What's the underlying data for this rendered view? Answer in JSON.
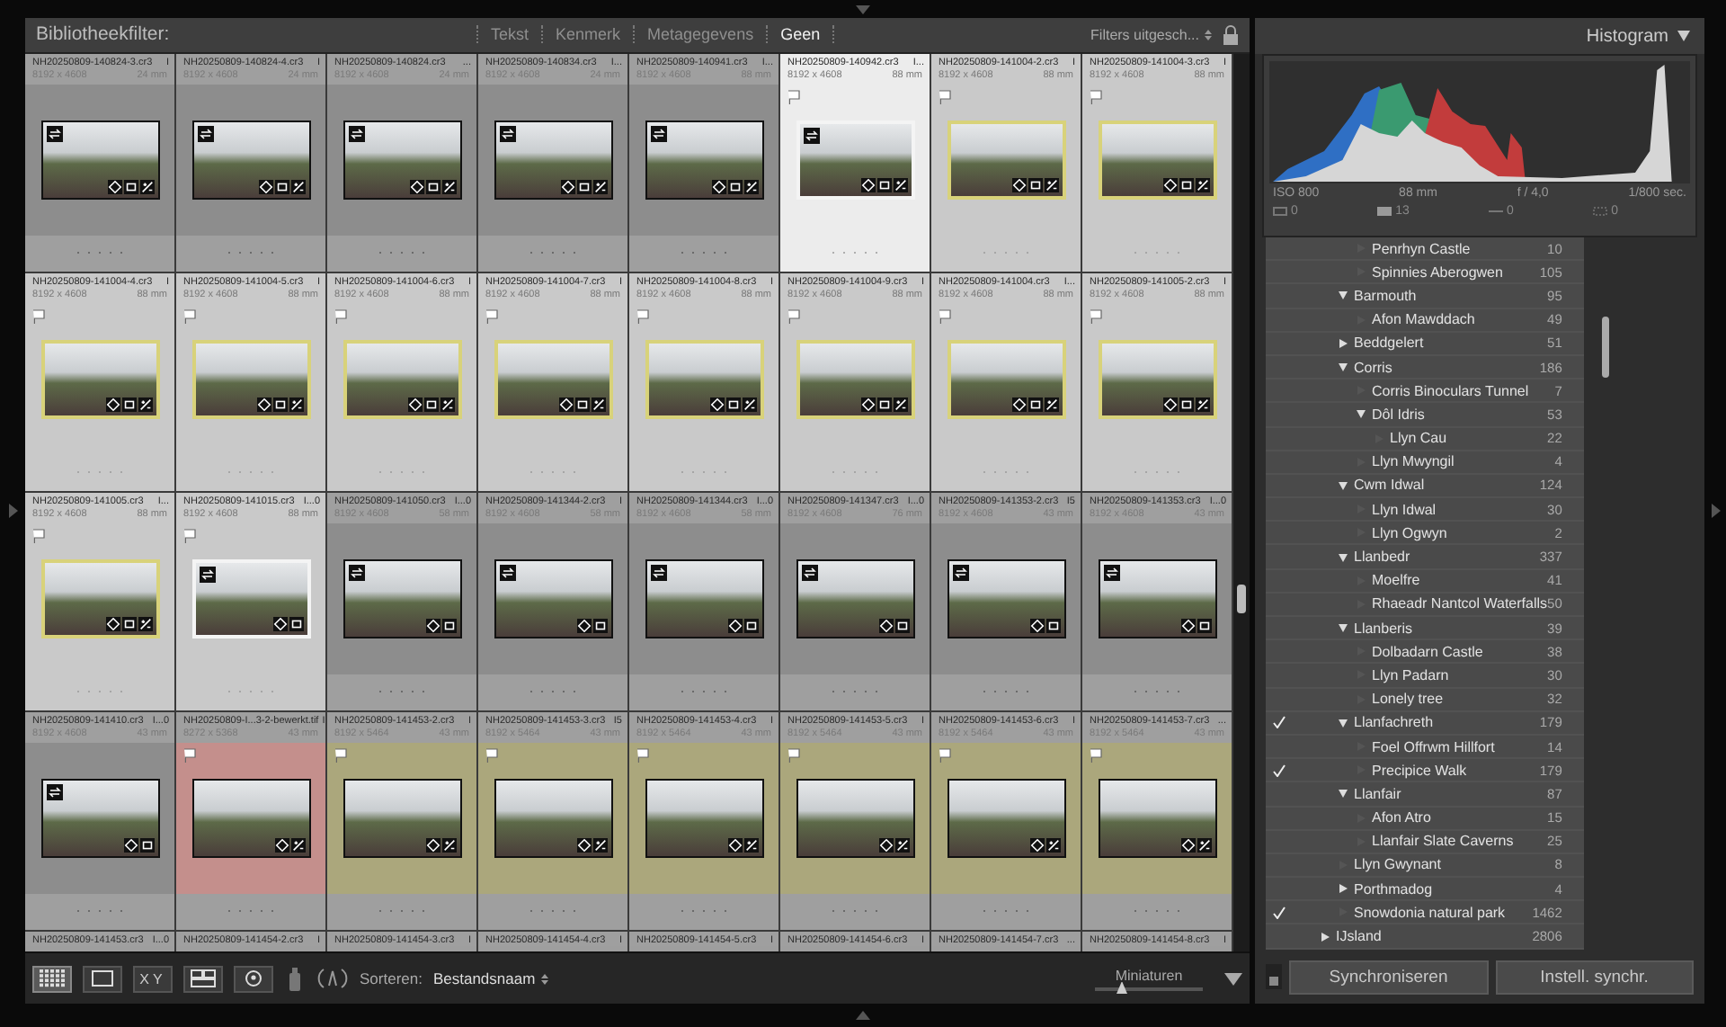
{
  "filter_bar": {
    "label": "Bibliotheekfilter:",
    "tabs": [
      {
        "label": "Tekst",
        "selected": false
      },
      {
        "label": "Kenmerk",
        "selected": false
      },
      {
        "label": "Metagegevens",
        "selected": false
      },
      {
        "label": "Geen",
        "selected": true
      }
    ],
    "preset": "Filters uitgesch..."
  },
  "thumbnails": [
    {
      "name": "NH20250809-140824-3.cr3",
      "extra": "I",
      "dims": "8192 x 4608",
      "focal": "24 mm",
      "selected": false,
      "active": false,
      "flag": false,
      "stars": 0,
      "virtual_copy": true,
      "keywords": true,
      "cropped": true,
      "edited": true
    },
    {
      "name": "NH20250809-140824-4.cr3",
      "extra": "I",
      "dims": "8192 x 4608",
      "focal": "24 mm",
      "selected": false,
      "active": false,
      "flag": false,
      "stars": 0,
      "virtual_copy": true,
      "keywords": true,
      "cropped": true,
      "edited": true
    },
    {
      "name": "NH20250809-140824.cr3",
      "extra": "...",
      "dims": "8192 x 4608",
      "focal": "24 mm",
      "selected": false,
      "active": false,
      "flag": false,
      "stars": 0,
      "virtual_copy": true,
      "keywords": true,
      "cropped": true,
      "edited": true
    },
    {
      "name": "NH20250809-140834.cr3",
      "extra": "I...",
      "dims": "8192 x 4608",
      "focal": "24 mm",
      "selected": false,
      "active": false,
      "flag": false,
      "stars": 0,
      "virtual_copy": true,
      "keywords": true,
      "cropped": true,
      "edited": true
    },
    {
      "name": "NH20250809-140941.cr3",
      "extra": "I...",
      "dims": "8192 x 4608",
      "focal": "88 mm",
      "selected": false,
      "active": false,
      "flag": false,
      "stars": 0,
      "virtual_copy": true,
      "keywords": true,
      "cropped": true,
      "edited": true
    },
    {
      "name": "NH20250809-140942.cr3",
      "extra": "I...",
      "dims": "8192 x 4608",
      "focal": "88 mm",
      "selected": true,
      "active": true,
      "flag": true,
      "stars": 0,
      "virtual_copy": true,
      "keywords": true,
      "cropped": true,
      "edited": true
    },
    {
      "name": "NH20250809-141004-2.cr3",
      "extra": "I",
      "dims": "8192 x 4608",
      "focal": "88 mm",
      "selected": true,
      "active": false,
      "flag": true,
      "stars": 0,
      "color": "#d8d27a",
      "virtual_copy": false,
      "keywords": true,
      "cropped": true,
      "edited": true
    },
    {
      "name": "NH20250809-141004-3.cr3",
      "extra": "I",
      "dims": "8192 x 4608",
      "focal": "88 mm",
      "selected": true,
      "active": false,
      "flag": true,
      "stars": 0,
      "color": "#d8d27a",
      "virtual_copy": false,
      "keywords": true,
      "cropped": true,
      "edited": true
    },
    {
      "name": "NH20250809-141004-4.cr3",
      "extra": "I",
      "dims": "8192 x 4608",
      "focal": "88 mm",
      "selected": true,
      "active": false,
      "flag": true,
      "stars": 0,
      "color": "#d8d27a",
      "virtual_copy": false,
      "keywords": true,
      "cropped": true,
      "edited": true
    },
    {
      "name": "NH20250809-141004-5.cr3",
      "extra": "I",
      "dims": "8192 x 4608",
      "focal": "88 mm",
      "selected": true,
      "active": false,
      "flag": true,
      "stars": 0,
      "color": "#d8d27a",
      "virtual_copy": false,
      "keywords": true,
      "cropped": true,
      "edited": true
    },
    {
      "name": "NH20250809-141004-6.cr3",
      "extra": "I",
      "dims": "8192 x 4608",
      "focal": "88 mm",
      "selected": true,
      "active": false,
      "flag": true,
      "stars": 0,
      "color": "#d8d27a",
      "virtual_copy": false,
      "keywords": true,
      "cropped": true,
      "edited": true
    },
    {
      "name": "NH20250809-141004-7.cr3",
      "extra": "I",
      "dims": "8192 x 4608",
      "focal": "88 mm",
      "selected": true,
      "active": false,
      "flag": true,
      "stars": 0,
      "color": "#d8d27a",
      "virtual_copy": false,
      "keywords": true,
      "cropped": true,
      "edited": true
    },
    {
      "name": "NH20250809-141004-8.cr3",
      "extra": "I",
      "dims": "8192 x 4608",
      "focal": "88 mm",
      "selected": true,
      "active": false,
      "flag": true,
      "stars": 0,
      "color": "#d8d27a",
      "virtual_copy": false,
      "keywords": true,
      "cropped": true,
      "edited": true
    },
    {
      "name": "NH20250809-141004-9.cr3",
      "extra": "I",
      "dims": "8192 x 4608",
      "focal": "88 mm",
      "selected": true,
      "active": false,
      "flag": true,
      "stars": 0,
      "color": "#d8d27a",
      "virtual_copy": false,
      "keywords": true,
      "cropped": true,
      "edited": true
    },
    {
      "name": "NH20250809-141004.cr3",
      "extra": "I...",
      "dims": "8192 x 4608",
      "focal": "88 mm",
      "selected": true,
      "active": false,
      "flag": true,
      "stars": 0,
      "color": "#d8d27a",
      "virtual_copy": false,
      "keywords": true,
      "cropped": true,
      "edited": true
    },
    {
      "name": "NH20250809-141005-2.cr3",
      "extra": "I",
      "dims": "8192 x 4608",
      "focal": "88 mm",
      "selected": true,
      "active": false,
      "flag": true,
      "stars": 0,
      "color": "#d8d27a",
      "virtual_copy": false,
      "keywords": true,
      "cropped": true,
      "edited": true
    },
    {
      "name": "NH20250809-141005.cr3",
      "extra": "I...",
      "dims": "8192 x 4608",
      "focal": "88 mm",
      "selected": true,
      "active": false,
      "flag": true,
      "stars": 0,
      "color": "#d8d27a",
      "virtual_copy": false,
      "keywords": true,
      "cropped": true,
      "edited": true
    },
    {
      "name": "NH20250809-141015.cr3",
      "extra": "I...0",
      "dims": "8192 x 4608",
      "focal": "88 mm",
      "selected": true,
      "active": false,
      "flag": true,
      "stars": 0,
      "virtual_copy": true,
      "keywords": true,
      "cropped": true,
      "edited": false
    },
    {
      "name": "NH20250809-141050.cr3",
      "extra": "I...0",
      "dims": "8192 x 4608",
      "focal": "58 mm",
      "selected": false,
      "active": false,
      "flag": false,
      "stars": 0,
      "virtual_copy": true,
      "keywords": true,
      "cropped": true,
      "edited": false
    },
    {
      "name": "NH20250809-141344-2.cr3",
      "extra": "I",
      "dims": "8192 x 4608",
      "focal": "58 mm",
      "selected": false,
      "active": false,
      "flag": false,
      "stars": 0,
      "virtual_copy": true,
      "keywords": true,
      "cropped": true,
      "edited": false
    },
    {
      "name": "NH20250809-141344.cr3",
      "extra": "I...0",
      "dims": "8192 x 4608",
      "focal": "58 mm",
      "selected": false,
      "active": false,
      "flag": false,
      "stars": 0,
      "virtual_copy": true,
      "keywords": true,
      "cropped": true,
      "edited": false
    },
    {
      "name": "NH20250809-141347.cr3",
      "extra": "I...0",
      "dims": "8192 x 4608",
      "focal": "76 mm",
      "selected": false,
      "active": false,
      "flag": false,
      "stars": 0,
      "virtual_copy": true,
      "keywords": true,
      "cropped": true,
      "edited": false
    },
    {
      "name": "NH20250809-141353-2.cr3",
      "extra": "I5",
      "dims": "8192 x 4608",
      "focal": "43 mm",
      "selected": false,
      "active": false,
      "flag": false,
      "stars": 0,
      "virtual_copy": true,
      "keywords": true,
      "cropped": true,
      "edited": false
    },
    {
      "name": "NH20250809-141353.cr3",
      "extra": "I...0",
      "dims": "8192 x 4608",
      "focal": "43 mm",
      "selected": false,
      "active": false,
      "flag": false,
      "stars": 0,
      "virtual_copy": true,
      "keywords": true,
      "cropped": true,
      "edited": false
    },
    {
      "name": "NH20250809-141410.cr3",
      "extra": "I...0",
      "dims": "8192 x 4608",
      "focal": "43 mm",
      "selected": false,
      "active": false,
      "flag": false,
      "stars": 0,
      "virtual_copy": true,
      "keywords": true,
      "cropped": true,
      "edited": false
    },
    {
      "name": "NH20250809-I...3-2-bewerkt.tif",
      "extra": "I",
      "dims": "8272 x 5368",
      "focal": "43 mm",
      "selected": false,
      "active": false,
      "flag": true,
      "stars": 0,
      "color": "#c48f8c",
      "virtual_copy": false,
      "keywords": true,
      "cropped": false,
      "edited": true
    },
    {
      "name": "NH20250809-141453-2.cr3",
      "extra": "I",
      "dims": "8192 x 5464",
      "focal": "43 mm",
      "selected": false,
      "active": false,
      "flag": true,
      "stars": 0,
      "color": "#aba77c",
      "virtual_copy": false,
      "keywords": true,
      "cropped": false,
      "edited": true
    },
    {
      "name": "NH20250809-141453-3.cr3",
      "extra": "I5",
      "dims": "8192 x 5464",
      "focal": "43 mm",
      "selected": false,
      "active": false,
      "flag": true,
      "stars": 0,
      "color": "#aba77c",
      "virtual_copy": false,
      "keywords": true,
      "cropped": false,
      "edited": true
    },
    {
      "name": "NH20250809-141453-4.cr3",
      "extra": "I",
      "dims": "8192 x 5464",
      "focal": "43 mm",
      "selected": false,
      "active": false,
      "flag": true,
      "stars": 0,
      "color": "#aba77c",
      "virtual_copy": false,
      "keywords": true,
      "cropped": false,
      "edited": true
    },
    {
      "name": "NH20250809-141453-5.cr3",
      "extra": "I",
      "dims": "8192 x 5464",
      "focal": "43 mm",
      "selected": false,
      "active": false,
      "flag": true,
      "stars": 0,
      "color": "#aba77c",
      "virtual_copy": false,
      "keywords": true,
      "cropped": false,
      "edited": true
    },
    {
      "name": "NH20250809-141453-6.cr3",
      "extra": "I",
      "dims": "8192 x 5464",
      "focal": "43 mm",
      "selected": false,
      "active": false,
      "flag": true,
      "stars": 0,
      "color": "#aba77c",
      "virtual_copy": false,
      "keywords": true,
      "cropped": false,
      "edited": true
    },
    {
      "name": "NH20250809-141453-7.cr3",
      "extra": "...",
      "dims": "8192 x 5464",
      "focal": "43 mm",
      "selected": false,
      "active": false,
      "flag": true,
      "stars": 0,
      "color": "#aba77c",
      "virtual_copy": false,
      "keywords": true,
      "cropped": false,
      "edited": true
    },
    {
      "name": "NH20250809-141453.cr3",
      "extra": "I...0"
    },
    {
      "name": "NH20250809-141454-2.cr3",
      "extra": "I"
    },
    {
      "name": "NH20250809-141454-3.cr3",
      "extra": "I"
    },
    {
      "name": "NH20250809-141454-4.cr3",
      "extra": "I"
    },
    {
      "name": "NH20250809-141454-5.cr3",
      "extra": "I"
    },
    {
      "name": "NH20250809-141454-6.cr3",
      "extra": "I"
    },
    {
      "name": "NH20250809-141454-7.cr3",
      "extra": "..."
    },
    {
      "name": "NH20250809-141454-8.cr3",
      "extra": "I"
    }
  ],
  "toolbar": {
    "views": [
      {
        "kind": "grid",
        "selected": true
      },
      {
        "kind": "loupe",
        "selected": false
      },
      {
        "kind": "compare",
        "label": "XY",
        "selected": false
      },
      {
        "kind": "survey",
        "selected": false
      },
      {
        "kind": "people",
        "selected": false
      }
    ],
    "sort_label": "Sorteren:",
    "sort_value": "Bestandsnaam",
    "size_label": "Miniaturen",
    "size": {
      "level": 0.25
    }
  },
  "histogram": {
    "title": "Histogram",
    "info": [
      "ISO 800",
      "88 mm",
      "f / 4,0",
      "1/800 sec."
    ],
    "counts": [
      "0",
      "13",
      "0",
      "0"
    ]
  },
  "keywords": [
    {
      "children": [
        {
          "children": [
            {
              "name": "Penrhyn Castle",
              "count": "10",
              "checked": false
            },
            {
              "name": "Spinnies Aberogwen",
              "count": "105",
              "checked": false
            }
          ]
        },
        {
          "name": "Barmouth",
          "count": "95",
          "checked": false,
          "expanded": true,
          "children": [
            {
              "name": "Afon Mawddach",
              "count": "49",
              "checked": false
            }
          ]
        },
        {
          "name": "Beddgelert",
          "count": "51",
          "checked": false,
          "expanded": false
        },
        {
          "name": "Corris",
          "count": "186",
          "checked": false,
          "expanded": true,
          "children": [
            {
              "name": "Corris Binoculars Tunnel",
              "count": "7",
              "checked": false
            },
            {
              "name": "Dôl Idris",
              "count": "53",
              "checked": false,
              "expanded": true,
              "children": [
                {
                  "name": "Llyn Cau",
                  "count": "22",
                  "checked": false
                }
              ]
            },
            {
              "name": "Llyn Mwyngil",
              "count": "4",
              "checked": false
            }
          ]
        },
        {
          "name": "Cwm Idwal",
          "count": "124",
          "checked": false,
          "expanded": true,
          "children": [
            {
              "name": "Llyn Idwal",
              "count": "30",
              "checked": false
            },
            {
              "name": "Llyn Ogwyn",
              "count": "2",
              "checked": false
            }
          ]
        },
        {
          "name": "Llanbedr",
          "count": "337",
          "checked": false,
          "expanded": true,
          "children": [
            {
              "name": "Moelfre",
              "count": "41",
              "checked": false
            },
            {
              "name": "Rhaeadr Nantcol Waterfalls",
              "count": "50",
              "checked": false
            }
          ]
        },
        {
          "name": "Llanberis",
          "count": "39",
          "checked": false,
          "expanded": true,
          "children": [
            {
              "name": "Dolbadarn Castle",
              "count": "38",
              "checked": false
            },
            {
              "name": "Llyn Padarn",
              "count": "30",
              "checked": false
            },
            {
              "name": "Lonely tree",
              "count": "32",
              "checked": false
            }
          ]
        },
        {
          "name": "Llanfachreth",
          "count": "179",
          "checked": true,
          "expanded": true,
          "children": [
            {
              "name": "Foel Offrwm Hillfort",
              "count": "14",
              "checked": false
            },
            {
              "name": "Precipice Walk",
              "count": "179",
              "checked": true
            }
          ]
        },
        {
          "name": "Llanfair",
          "count": "87",
          "checked": false,
          "expanded": true,
          "children": [
            {
              "name": "Afon Atro",
              "count": "15",
              "checked": false
            },
            {
              "name": "Llanfair Slate Caverns",
              "count": "25",
              "checked": false
            }
          ]
        },
        {
          "name": "Llyn Gwynant",
          "count": "8",
          "checked": false
        },
        {
          "name": "Porthmadog",
          "count": "4",
          "checked": false,
          "expanded": false
        },
        {
          "name": "Snowdonia natural park",
          "count": "1462",
          "checked": true
        }
      ]
    },
    {
      "name": "IJsland",
      "count": "2806",
      "checked": false,
      "expanded": false
    }
  ],
  "sync": {
    "buttons": [
      "Synchroniseren",
      "Instell. synchr."
    ]
  }
}
